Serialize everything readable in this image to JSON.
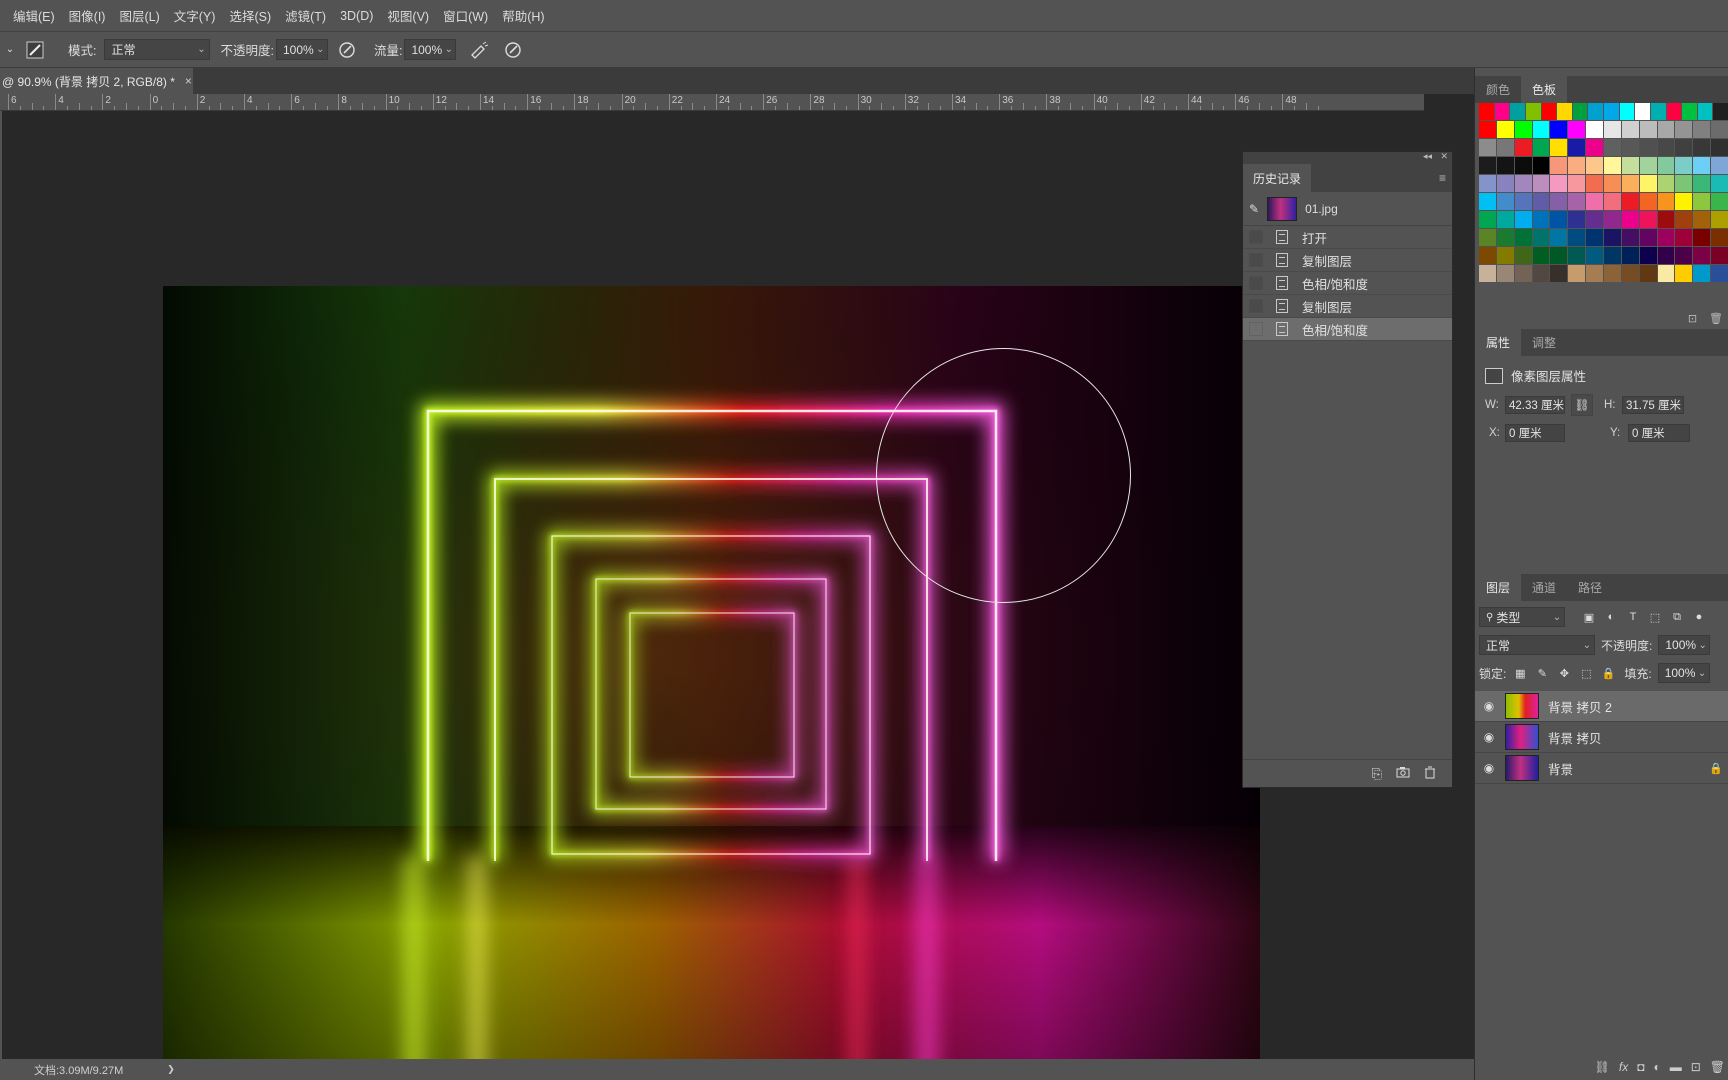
{
  "menu": [
    "编辑(E)",
    "图像(I)",
    "图层(L)",
    "文字(Y)",
    "选择(S)",
    "滤镜(T)",
    "3D(D)",
    "视图(V)",
    "窗口(W)",
    "帮助(H)"
  ],
  "options": {
    "mode_label": "模式:",
    "mode_value": "正常",
    "opacity_label": "不透明度:",
    "opacity_value": "100%",
    "flow_label": "流量:",
    "flow_value": "100%"
  },
  "document": {
    "tab_title": "@ 90.9% (背景 拷贝 2, RGB/8) *",
    "close": "×",
    "status": "文档:3.09M/9.27M",
    "status_arrow": "❯"
  },
  "ruler_numbers": [
    "6",
    "4",
    "2",
    "0",
    "2",
    "4",
    "6",
    "8",
    "10",
    "12",
    "14",
    "16",
    "18",
    "20",
    "22",
    "24",
    "26",
    "28",
    "30",
    "32",
    "34",
    "36",
    "38",
    "40",
    "42",
    "44",
    "46",
    "48"
  ],
  "history": {
    "title": "历史记录",
    "snapshot": "01.jpg",
    "items": [
      "打开",
      "复制图层",
      "色相/饱和度",
      "复制图层",
      "色相/饱和度"
    ],
    "active_index": 4
  },
  "dock": {
    "color_tabs": [
      "颜色",
      "色板"
    ],
    "props_tabs": [
      "属性",
      "调整"
    ],
    "props_title": "像素图层属性",
    "w_label": "W:",
    "w_value": "42.33 厘米",
    "h_label": "H:",
    "h_value": "31.75 厘米",
    "x_label": "X:",
    "x_value": "0 厘米",
    "y_label": "Y:",
    "y_value": "0 厘米",
    "layers_tabs": [
      "图层",
      "通道",
      "路径"
    ],
    "filter_kind": "类型",
    "blend_mode": "正常",
    "opacity_label": "不透明度:",
    "opacity_value": "100%",
    "lock_label": "锁定:",
    "fill_label": "填充:",
    "fill_value": "100%",
    "layers": [
      {
        "name": "背景 拷贝 2",
        "selected": true,
        "locked": false
      },
      {
        "name": "背景 拷贝",
        "selected": false,
        "locked": false
      },
      {
        "name": "背景",
        "selected": false,
        "locked": true
      }
    ]
  },
  "swatch_colors": [
    [
      "#ff0000",
      "#ff0088",
      "#00a0a0",
      "#80c000",
      "#ff0000",
      "#ffd800",
      "#00a040",
      "#00a0d0",
      "#00a8e8",
      "#00ffff",
      "#ffffff",
      "#00b0b0",
      "#ff0040",
      "#00c040",
      "#00c0c0",
      "#202020"
    ],
    [
      "#ff0000",
      "#ffff00",
      "#00ff00",
      "#00ffff",
      "#0000ff",
      "#ff00ff",
      "#ffffff",
      "#e6e6e6",
      "#d0d0d0",
      "#bcbcbc",
      "#a8a8a8",
      "#949494",
      "#808080",
      "#6c6c6c"
    ],
    [
      "#8c8c8c",
      "#777777",
      "#ec1c24",
      "#00a650",
      "#ffde00",
      "#1a1aa8",
      "#ec008c",
      "#606060",
      "#585858",
      "#505050",
      "#484848",
      "#404040",
      "#383838",
      "#303030"
    ],
    [
      "#1c1c1c",
      "#141414",
      "#0c0c0c",
      "#000000",
      "#f7977a",
      "#f9ad81",
      "#fdc68a",
      "#fff79a",
      "#c4df9b",
      "#a3d39c",
      "#82ca9d",
      "#7bcdc8",
      "#6ecff6",
      "#7ea7d8"
    ],
    [
      "#8493ca",
      "#8882be",
      "#a187be",
      "#bc8dbf",
      "#f49ac2",
      "#f6989d",
      "#f26c4f",
      "#f68e55",
      "#fbaf5c",
      "#fff467",
      "#acd372",
      "#7cc576",
      "#3bb878",
      "#1abbb4"
    ],
    [
      "#00bff3",
      "#438ccb",
      "#5574b9",
      "#605ca8",
      "#855fa8",
      "#a763a8",
      "#f06ea9",
      "#f26d7d",
      "#ed1c24",
      "#f26522",
      "#f7941d",
      "#fff200",
      "#8dc63f",
      "#39b54a"
    ],
    [
      "#00a651",
      "#00a99d",
      "#00aeef",
      "#0072bc",
      "#0054a6",
      "#2e3192",
      "#662d91",
      "#92278f",
      "#ec008c",
      "#ed145b",
      "#9e0b0f",
      "#a0410d",
      "#a3620a",
      "#aba000"
    ],
    [
      "#598527",
      "#1a7b30",
      "#007236",
      "#00746b",
      "#0076a3",
      "#004b80",
      "#003471",
      "#1b1464",
      "#440e62",
      "#630460",
      "#9e005d",
      "#9e0039",
      "#790000",
      "#7b2e00"
    ],
    [
      "#7d4900",
      "#827b00",
      "#406618",
      "#005e20",
      "#005826",
      "#005952",
      "#005b7f",
      "#003663",
      "#002157",
      "#0d004c",
      "#32004b",
      "#4b0049",
      "#7b0046",
      "#7a0026"
    ],
    [
      "#c7b299",
      "#998675",
      "#736357",
      "#534741",
      "#37302a",
      "#c69c6d",
      "#a67c52",
      "#8c6239",
      "#754c24",
      "#603913",
      "#f9e9a4",
      "#ffcc00",
      "#0099cc",
      "#2a4f9a"
    ]
  ]
}
